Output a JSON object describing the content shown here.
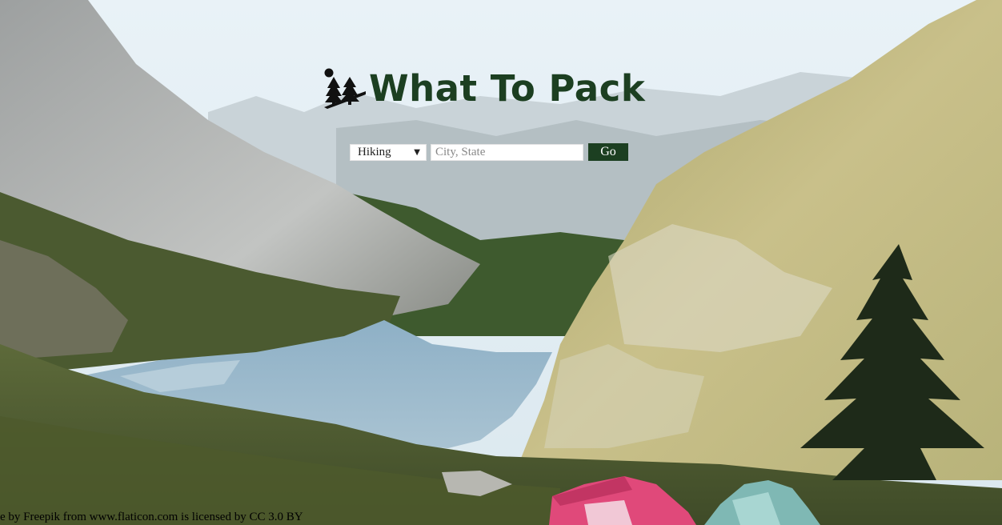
{
  "header": {
    "title": "What To Pack",
    "logo_icon": "trees-icon"
  },
  "search": {
    "activity_selected": "Hiking",
    "location_placeholder": "City, State",
    "location_value": "",
    "go_label": "Go"
  },
  "footer": {
    "credit": "e by Freepik from www.flaticon.com is licensed by CC 3.0 BY"
  },
  "colors": {
    "brand": "#1c3f21",
    "button_text": "#ffffff"
  }
}
